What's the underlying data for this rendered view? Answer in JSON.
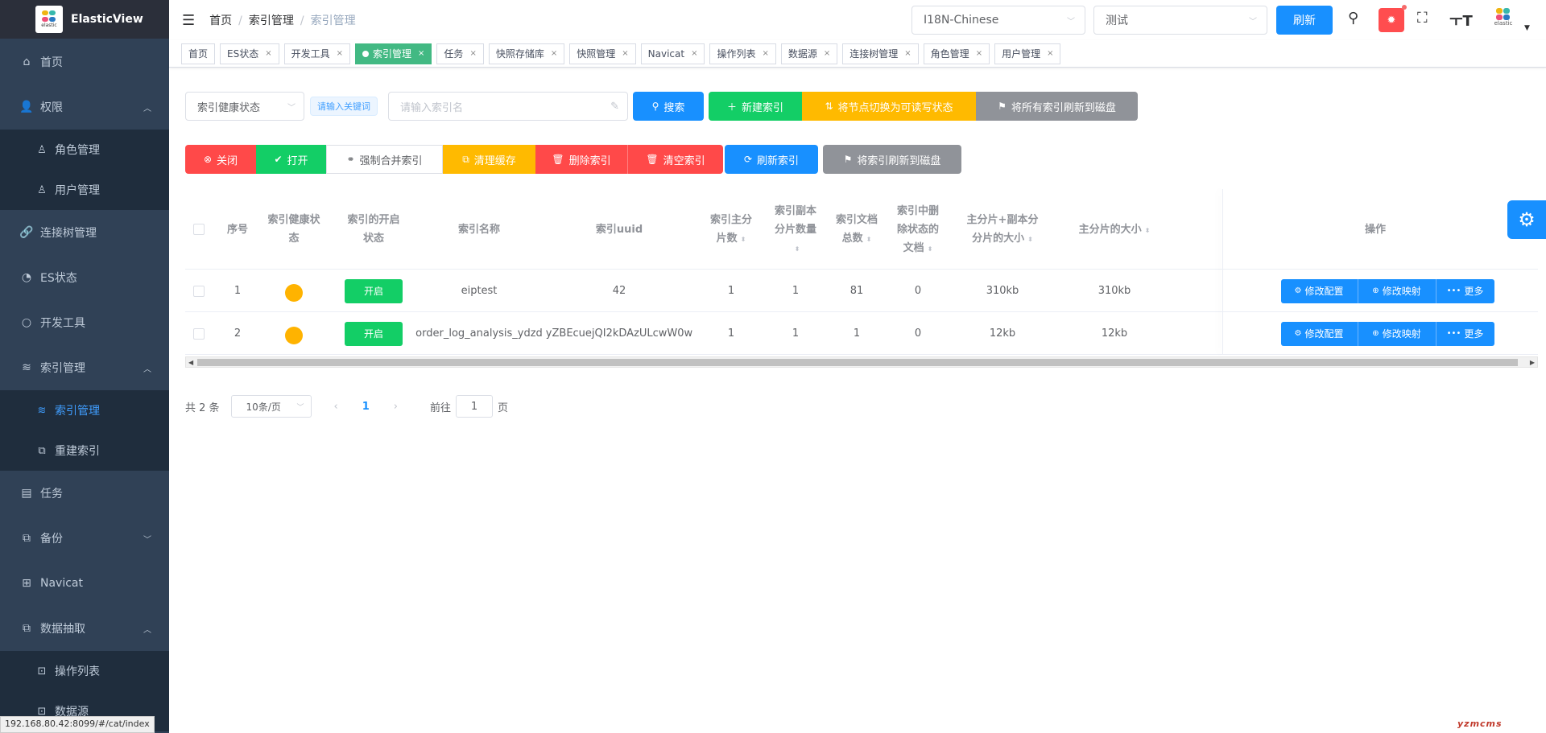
{
  "app": {
    "title": "ElasticView",
    "logo_sub": "elastic"
  },
  "sidebar": {
    "items": [
      {
        "label": "首页",
        "icon": "home-icon"
      },
      {
        "label": "权限",
        "icon": "user-icon"
      },
      {
        "label": "角色管理",
        "icon": "user-tie-icon"
      },
      {
        "label": "用户管理",
        "icon": "user-outline-icon"
      },
      {
        "label": "连接树管理",
        "icon": "link-icon"
      },
      {
        "label": "ES状态",
        "icon": "pie-chart-icon"
      },
      {
        "label": "开发工具",
        "icon": "search-icon"
      },
      {
        "label": "索引管理",
        "icon": "database-icon"
      },
      {
        "label": "索引管理",
        "icon": "database-icon"
      },
      {
        "label": "重建索引",
        "icon": "copy-icon"
      },
      {
        "label": "任务",
        "icon": "document-icon"
      },
      {
        "label": "备份",
        "icon": "copy-icon"
      },
      {
        "label": "Navicat",
        "icon": "toolbox-icon"
      },
      {
        "label": "数据抽取",
        "icon": "copy-icon"
      },
      {
        "label": "操作列表",
        "icon": "bag-icon"
      },
      {
        "label": "数据源",
        "icon": "bag-icon"
      }
    ]
  },
  "status_url": "192.168.80.42:8099/#/cat/index",
  "navbar": {
    "breadcrumb": [
      "首页",
      "索引管理",
      "索引管理"
    ],
    "lang_select": "I18N-Chinese",
    "conn_select": "测试",
    "refresh_label": "刷新"
  },
  "tags": [
    {
      "label": "首页",
      "closable": false
    },
    {
      "label": "ES状态",
      "closable": true
    },
    {
      "label": "开发工具",
      "closable": true
    },
    {
      "label": "索引管理",
      "closable": true,
      "active": true
    },
    {
      "label": "任务",
      "closable": true
    },
    {
      "label": "快照存储库",
      "closable": true
    },
    {
      "label": "快照管理",
      "closable": true
    },
    {
      "label": "Navicat",
      "closable": true
    },
    {
      "label": "操作列表",
      "closable": true
    },
    {
      "label": "数据源",
      "closable": true
    },
    {
      "label": "连接树管理",
      "closable": true
    },
    {
      "label": "角色管理",
      "closable": true
    },
    {
      "label": "用户管理",
      "closable": true
    }
  ],
  "filter": {
    "health_select": "索引健康状态",
    "keyword_tag": "请输入关键词",
    "index_placeholder": "请输入索引名",
    "search": "搜索",
    "new_index": "新建索引",
    "readwrite": "将节点切换为可读写状态",
    "flush_all": "将所有索引刷新到磁盘"
  },
  "actions": {
    "close": "关闭",
    "open": "打开",
    "forcemerge": "强制合并索引",
    "clear_cache": "清理缓存",
    "delete_index": "删除索引",
    "empty_index": "清空索引",
    "refresh_index": "刷新索引",
    "flush": "将索引刷新到磁盘"
  },
  "table": {
    "headers": {
      "seq": "序号",
      "health_1": "索引健康状",
      "health_2": "态",
      "status_1": "索引的开启",
      "status_2": "状态",
      "name": "索引名称",
      "uuid": "索引uuid",
      "pri_1": "索引主分",
      "pri_2": "片数",
      "rep_1": "索引副本",
      "rep_2": "分片数量",
      "docs_1": "索引文档",
      "docs_2": "总数",
      "del_1": "索引中删",
      "del_2": "除状态的",
      "del_3": "文档",
      "store_1": "主分片+副本分",
      "store_2": "分片的大小",
      "pri_store": "主分片的大小",
      "ops": "操作"
    },
    "rows": [
      {
        "seq": "1",
        "status": "开启",
        "name": "eiptest",
        "uuid": "42",
        "pri": "1",
        "rep": "1",
        "docs": "81",
        "deleted": "0",
        "store": "310kb",
        "pri_store": "310kb",
        "health_color": "#ffb300"
      },
      {
        "seq": "2",
        "status": "开启",
        "name": "order_log_analysis_ydzd",
        "uuid": "yZBEcuejQI2kDAzULcwW0w",
        "pri": "1",
        "rep": "1",
        "docs": "1",
        "deleted": "0",
        "store": "12kb",
        "pri_store": "12kb",
        "health_color": "#ffb300"
      }
    ],
    "op_buttons": {
      "config": "修改配置",
      "mapping": "修改映射",
      "more": "更多"
    }
  },
  "pagination": {
    "total": "共 2 条",
    "page_size": "10条/页",
    "current": "1",
    "goto_prefix": "前往",
    "goto_value": "1",
    "goto_suffix": "页"
  },
  "watermark": "yzmcms",
  "colors": {
    "sidebar_bg": "#304156",
    "primary": "#1890ff",
    "success": "#13ce66",
    "warning": "#ffba00",
    "danger": "#ff4949",
    "info": "#909399"
  }
}
